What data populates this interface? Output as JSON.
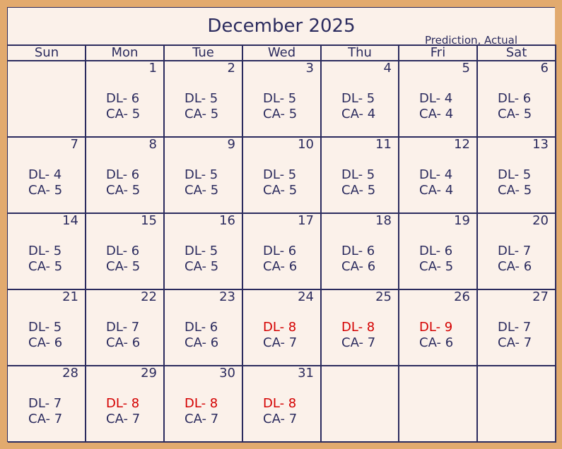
{
  "title": "December 2025",
  "legend": "Prediction, Actual",
  "day_names": [
    "Sun",
    "Mon",
    "Tue",
    "Wed",
    "Thu",
    "Fri",
    "Sat"
  ],
  "colors": {
    "border": "#2b2b5e",
    "frame": "#e2aa6e",
    "background": "#fbf1ea",
    "text": "#2b2b5e",
    "highlight": "#d40000"
  },
  "weeks": [
    [
      null,
      {
        "day": "1",
        "dl": "DL- 6",
        "ca": "CA- 5",
        "high": false
      },
      {
        "day": "2",
        "dl": "DL- 5",
        "ca": "CA- 5",
        "high": false
      },
      {
        "day": "3",
        "dl": "DL- 5",
        "ca": "CA- 5",
        "high": false
      },
      {
        "day": "4",
        "dl": "DL- 5",
        "ca": "CA- 4",
        "high": false
      },
      {
        "day": "5",
        "dl": "DL- 4",
        "ca": "CA- 4",
        "high": false
      },
      {
        "day": "6",
        "dl": "DL- 6",
        "ca": "CA- 5",
        "high": false
      }
    ],
    [
      {
        "day": "7",
        "dl": "DL- 4",
        "ca": "CA- 5",
        "high": false
      },
      {
        "day": "8",
        "dl": "DL- 6",
        "ca": "CA- 5",
        "high": false
      },
      {
        "day": "9",
        "dl": "DL- 5",
        "ca": "CA- 5",
        "high": false
      },
      {
        "day": "10",
        "dl": "DL- 5",
        "ca": "CA- 5",
        "high": false
      },
      {
        "day": "11",
        "dl": "DL- 5",
        "ca": "CA- 5",
        "high": false
      },
      {
        "day": "12",
        "dl": "DL- 4",
        "ca": "CA- 4",
        "high": false
      },
      {
        "day": "13",
        "dl": "DL- 5",
        "ca": "CA- 5",
        "high": false
      }
    ],
    [
      {
        "day": "14",
        "dl": "DL- 5",
        "ca": "CA- 5",
        "high": false
      },
      {
        "day": "15",
        "dl": "DL- 6",
        "ca": "CA- 5",
        "high": false
      },
      {
        "day": "16",
        "dl": "DL- 5",
        "ca": "CA- 5",
        "high": false
      },
      {
        "day": "17",
        "dl": "DL- 6",
        "ca": "CA- 6",
        "high": false
      },
      {
        "day": "18",
        "dl": "DL- 6",
        "ca": "CA- 6",
        "high": false
      },
      {
        "day": "19",
        "dl": "DL- 6",
        "ca": "CA- 5",
        "high": false
      },
      {
        "day": "20",
        "dl": "DL- 7",
        "ca": "CA- 6",
        "high": false
      }
    ],
    [
      {
        "day": "21",
        "dl": "DL- 5",
        "ca": "CA- 6",
        "high": false
      },
      {
        "day": "22",
        "dl": "DL- 7",
        "ca": "CA- 6",
        "high": false
      },
      {
        "day": "23",
        "dl": "DL- 6",
        "ca": "CA- 6",
        "high": false
      },
      {
        "day": "24",
        "dl": "DL- 8",
        "ca": "CA- 7",
        "high": true
      },
      {
        "day": "25",
        "dl": "DL- 8",
        "ca": "CA- 7",
        "high": true
      },
      {
        "day": "26",
        "dl": "DL- 9",
        "ca": "CA- 6",
        "high": true
      },
      {
        "day": "27",
        "dl": "DL- 7",
        "ca": "CA- 7",
        "high": false
      }
    ],
    [
      {
        "day": "28",
        "dl": "DL- 7",
        "ca": "CA- 7",
        "high": false
      },
      {
        "day": "29",
        "dl": "DL- 8",
        "ca": "CA- 7",
        "high": true
      },
      {
        "day": "30",
        "dl": "DL- 8",
        "ca": "CA- 7",
        "high": true
      },
      {
        "day": "31",
        "dl": "DL- 8",
        "ca": "CA- 7",
        "high": true
      },
      null,
      null,
      null
    ]
  ]
}
